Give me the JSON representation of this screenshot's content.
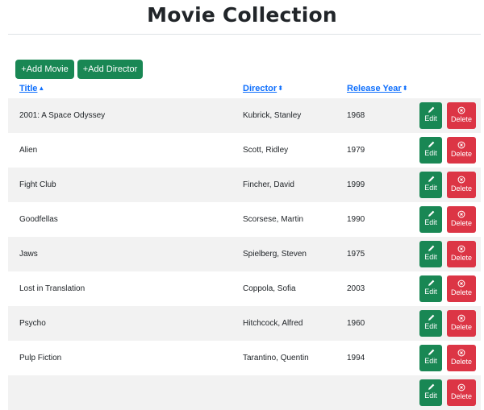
{
  "page": {
    "title": "Movie Collection"
  },
  "toolbar": {
    "add_movie_label": "+Add Movie",
    "add_director_label": "+Add Director"
  },
  "table": {
    "columns": [
      {
        "label": "Title",
        "sort": "ascending",
        "sort_icon": "caret-up-icon"
      },
      {
        "label": "Director",
        "sort": "unsorted",
        "sort_icon": "sort-arrows-icon"
      },
      {
        "label": "Release Year",
        "sort": "unsorted",
        "sort_icon": "sort-arrows-icon"
      }
    ],
    "action_labels": {
      "edit": "Edit",
      "delete": "Delete"
    },
    "rows": [
      {
        "title": "2001: A Space Odyssey",
        "director": "Kubrick, Stanley",
        "year": "1968"
      },
      {
        "title": "Alien",
        "director": "Scott, Ridley",
        "year": "1979"
      },
      {
        "title": "Fight Club",
        "director": "Fincher, David",
        "year": "1999"
      },
      {
        "title": "Goodfellas",
        "director": "Scorsese, Martin",
        "year": "1990"
      },
      {
        "title": "Jaws",
        "director": "Spielberg, Steven",
        "year": "1975"
      },
      {
        "title": "Lost in Translation",
        "director": "Coppola, Sofia",
        "year": "2003"
      },
      {
        "title": "Psycho",
        "director": "Hitchcock, Alfred",
        "year": "1960"
      },
      {
        "title": "Pulp Fiction",
        "director": "Tarantino, Quentin",
        "year": "1994"
      },
      {
        "title": "",
        "director": "",
        "year": ""
      }
    ]
  },
  "colors": {
    "primary_link": "#0d6efd",
    "success": "#198754",
    "danger": "#dc3545",
    "stripe": "#f2f2f2"
  }
}
